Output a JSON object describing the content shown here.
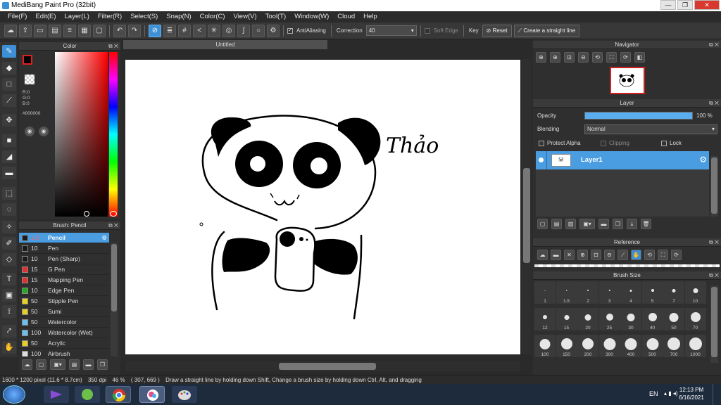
{
  "window": {
    "title": "MediBang Paint Pro (32bit)",
    "controls": [
      "—",
      "❐",
      "✕"
    ]
  },
  "menu": [
    "File(F)",
    "Edit(E)",
    "Layer(L)",
    "Filter(R)",
    "Select(S)",
    "Snap(N)",
    "Color(C)",
    "View(V)",
    "Tool(T)",
    "Window(W)",
    "Cloud",
    "Help"
  ],
  "toolbar": {
    "antialiasing_label": "AntiAliasing",
    "correction_label": "Correction",
    "correction_value": "40",
    "soft_edge_label": "Soft Edge",
    "key_label": "Key",
    "reset_label": "Reset",
    "straight_line_label": "Create a straight line"
  },
  "color_panel": {
    "title": "Color",
    "r": "R:0",
    "g": "G:0",
    "b": "B:0",
    "hex": "#000000"
  },
  "brush_panel": {
    "title": "Brush: Pencil",
    "items": [
      {
        "size": "1.0",
        "name": "Pencil",
        "color": "#1a1a1a",
        "selected": true
      },
      {
        "size": "10",
        "name": "Pen",
        "color": "#1a1a1a"
      },
      {
        "size": "10",
        "name": "Pen (Sharp)",
        "color": "#1a1a1a"
      },
      {
        "size": "15",
        "name": "G Pen",
        "color": "#e03030"
      },
      {
        "size": "15",
        "name": "Mapping Pen",
        "color": "#e03030"
      },
      {
        "size": "10",
        "name": "Edge Pen",
        "color": "#22aa22"
      },
      {
        "size": "50",
        "name": "Stipple Pen",
        "color": "#e8d020"
      },
      {
        "size": "50",
        "name": "Sumi",
        "color": "#e8d020"
      },
      {
        "size": "50",
        "name": "Watercolor",
        "color": "#6ac0f0"
      },
      {
        "size": "100",
        "name": "Watercolor (Wet)",
        "color": "#6ac0f0"
      },
      {
        "size": "50",
        "name": "Acrylic",
        "color": "#e8d020"
      },
      {
        "size": "100",
        "name": "Airbrush",
        "color": "#dddddd"
      }
    ]
  },
  "canvas": {
    "tab": "Untitled",
    "signature": "Thảo"
  },
  "navigator": {
    "title": "Navigator"
  },
  "layer_panel": {
    "title": "Layer",
    "opacity_label": "Opacity",
    "opacity_value": "100 %",
    "opacity_fraction": 1.0,
    "blending_label": "Blending",
    "blending_value": "Normal",
    "protect_alpha": "Protect Alpha",
    "clipping": "Clipping",
    "lock": "Lock",
    "layer_name": "Layer1"
  },
  "reference": {
    "title": "Reference"
  },
  "brush_size": {
    "title": "Brush Size",
    "sizes": [
      "1",
      "1.5",
      "2",
      "3",
      "4",
      "5",
      "7",
      "10",
      "12",
      "15",
      "20",
      "25",
      "30",
      "40",
      "50",
      "70",
      "100",
      "150",
      "200",
      "300",
      "400",
      "500",
      "700",
      "1000"
    ]
  },
  "status": {
    "dims": "1600 * 1200 pixel",
    "cm": "(11.6 * 8.7cm)",
    "dpi": "350 dpi",
    "zoom": "46 %",
    "coords": "( 307, 669 )",
    "hint": "Draw a straight line by holding down Shift, Change a brush size by holding down Ctrl, Alt, and dragging"
  },
  "taskbar": {
    "lang": "EN",
    "time": "12:13 PM",
    "date": "6/16/2021"
  }
}
